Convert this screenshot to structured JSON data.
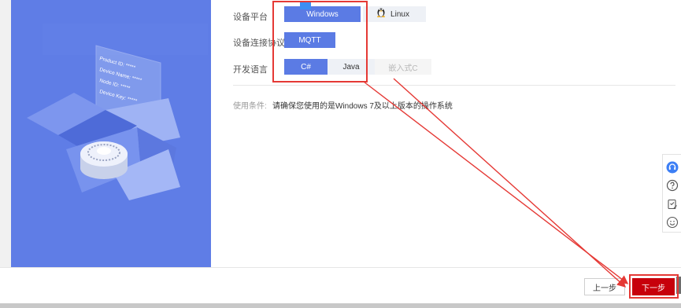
{
  "colors": {
    "accent": "#5b7be4",
    "primary_button": "#c7000b",
    "annotation": "#e53935",
    "hero": "#5f7de6"
  },
  "illustration": {
    "card_lines": [
      "Product ID: *****",
      "Device Name: *****",
      "Node ID: *****",
      "Device Key: *****"
    ]
  },
  "form": {
    "platform": {
      "label": "设备平台",
      "options": [
        {
          "label": "Windows",
          "icon": "windows-icon",
          "state": "selected"
        },
        {
          "label": "Linux",
          "icon": "linux-icon",
          "state": "unselected"
        }
      ]
    },
    "protocol": {
      "label": "设备连接协议",
      "options": [
        {
          "label": "MQTT",
          "state": "selected"
        }
      ]
    },
    "language": {
      "label": "开发语言",
      "options": [
        {
          "label": "C#",
          "state": "selected"
        },
        {
          "label": "Java",
          "state": "unselected"
        },
        {
          "label": "嵌入式C",
          "state": "disabled"
        }
      ]
    }
  },
  "condition": {
    "label": "使用条件:",
    "text": "请确保您使用的是Windows 7及以上版本的操作系统"
  },
  "side_tools": [
    "headset-icon",
    "help-icon",
    "feedback-icon",
    "smile-icon"
  ],
  "footer": {
    "prev_label": "上一步",
    "next_label": "下一步"
  }
}
